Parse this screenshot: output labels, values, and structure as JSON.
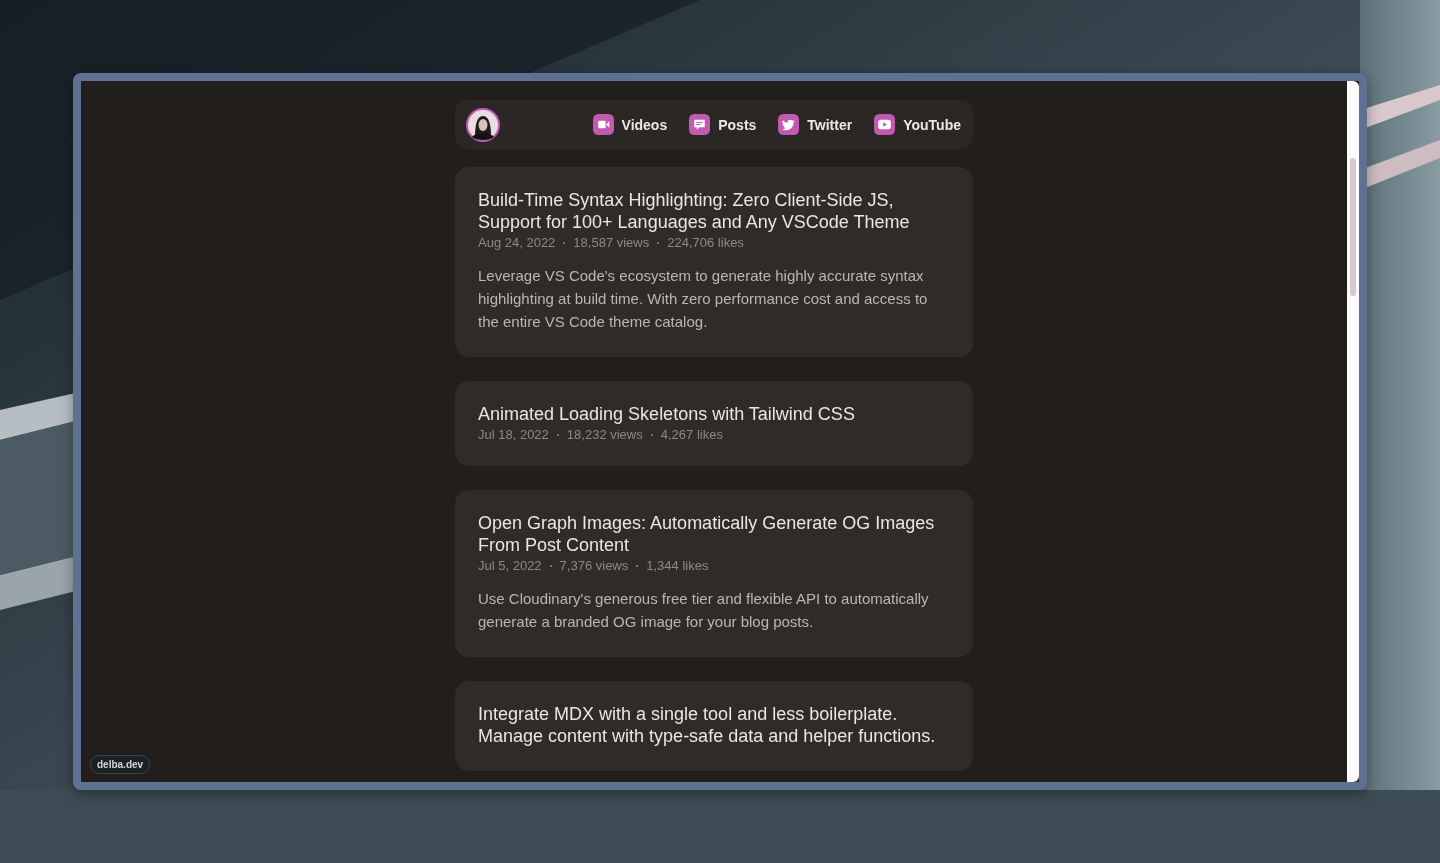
{
  "nav": {
    "links": [
      {
        "label": "Videos",
        "kind": "video"
      },
      {
        "label": "Posts",
        "kind": "chat"
      },
      {
        "label": "Twitter",
        "kind": "bird"
      },
      {
        "label": "YouTube",
        "kind": "play"
      }
    ]
  },
  "posts": [
    {
      "title": "Build-Time Syntax Highlighting: Zero Client-Side JS, Support for 100+ Languages and Any VSCode Theme",
      "date": "Aug 24, 2022",
      "views": "18,587 views",
      "likes": "224,706 likes",
      "description": "Leverage VS Code's ecosystem to generate highly accurate syntax highlighting at build time. With zero performance cost and access to the entire VS Code theme catalog."
    },
    {
      "title": "Animated Loading Skeletons with Tailwind CSS",
      "date": "Jul 18, 2022",
      "views": "18,232 views",
      "likes": "4,267 likes"
    },
    {
      "title": "Open Graph Images: Automatically Generate OG Images From Post Content",
      "date": "Jul 5, 2022",
      "views": "7,376 views",
      "likes": "1,344 likes",
      "description": "Use Cloudinary's generous free tier and flexible API to automatically generate a branded OG image for your blog posts."
    },
    {
      "title": "Integrate MDX with a single tool and less boilerplate. Manage content with type-safe data and helper functions."
    }
  ],
  "badge": "delba.dev"
}
